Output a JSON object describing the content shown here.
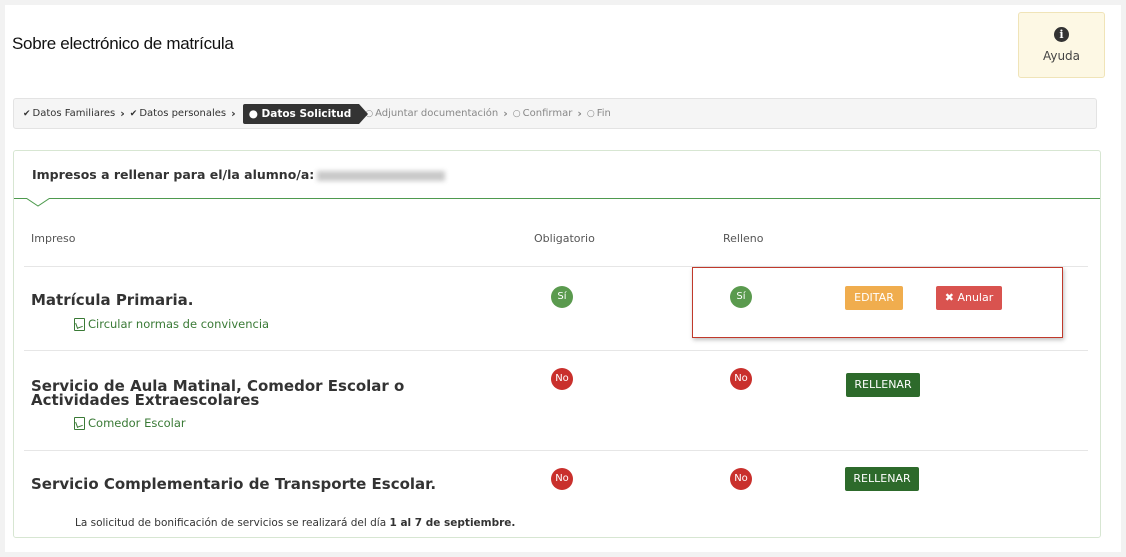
{
  "header": {
    "title": "Sobre electrónico de matrícula"
  },
  "help": {
    "icon": "info-icon",
    "label": "Ayuda"
  },
  "steps": [
    {
      "label": "Datos Familiares",
      "state": "done"
    },
    {
      "label": "Datos personales",
      "state": "done"
    },
    {
      "label": "Datos Solicitud",
      "state": "active"
    },
    {
      "label": "Adjuntar documentación",
      "state": "pending"
    },
    {
      "label": "Confirmar",
      "state": "pending"
    },
    {
      "label": "Fin",
      "state": "pending"
    }
  ],
  "card": {
    "title": "Impresos a rellenar para el/la alumno/a:"
  },
  "columns": {
    "impreso": "Impreso",
    "obligatorio": "Obligatorio",
    "relleno": "Relleno"
  },
  "rows": [
    {
      "title": "Matrícula Primaria.",
      "link": "Circular normas de convivencia",
      "obligatorio": "Sí",
      "relleno": "Sí",
      "edit_label": "EDITAR",
      "cancel_label": "✖ Anular"
    },
    {
      "title_line1": "Servicio de Aula Matinal, Comedor Escolar o",
      "title_line2": "Actividades Extraescolares",
      "link": "Comedor Escolar",
      "obligatorio": "No",
      "relleno": "No",
      "action_label": "RELLENAR"
    },
    {
      "title": "Servicio Complementario de Transporte Escolar.",
      "obligatorio": "No",
      "relleno": "No",
      "action_label": "RELLENAR"
    }
  ],
  "note": {
    "prefix": "La solicitud de bonificación de servicios se realizará del día ",
    "bold": "1 al 7 de septiembre."
  },
  "colors": {
    "yes": "#5a9a4e",
    "no": "#c9302c",
    "edit": "#f0ad4e",
    "cancel": "#d9534f",
    "fill": "#2d6a2b"
  }
}
